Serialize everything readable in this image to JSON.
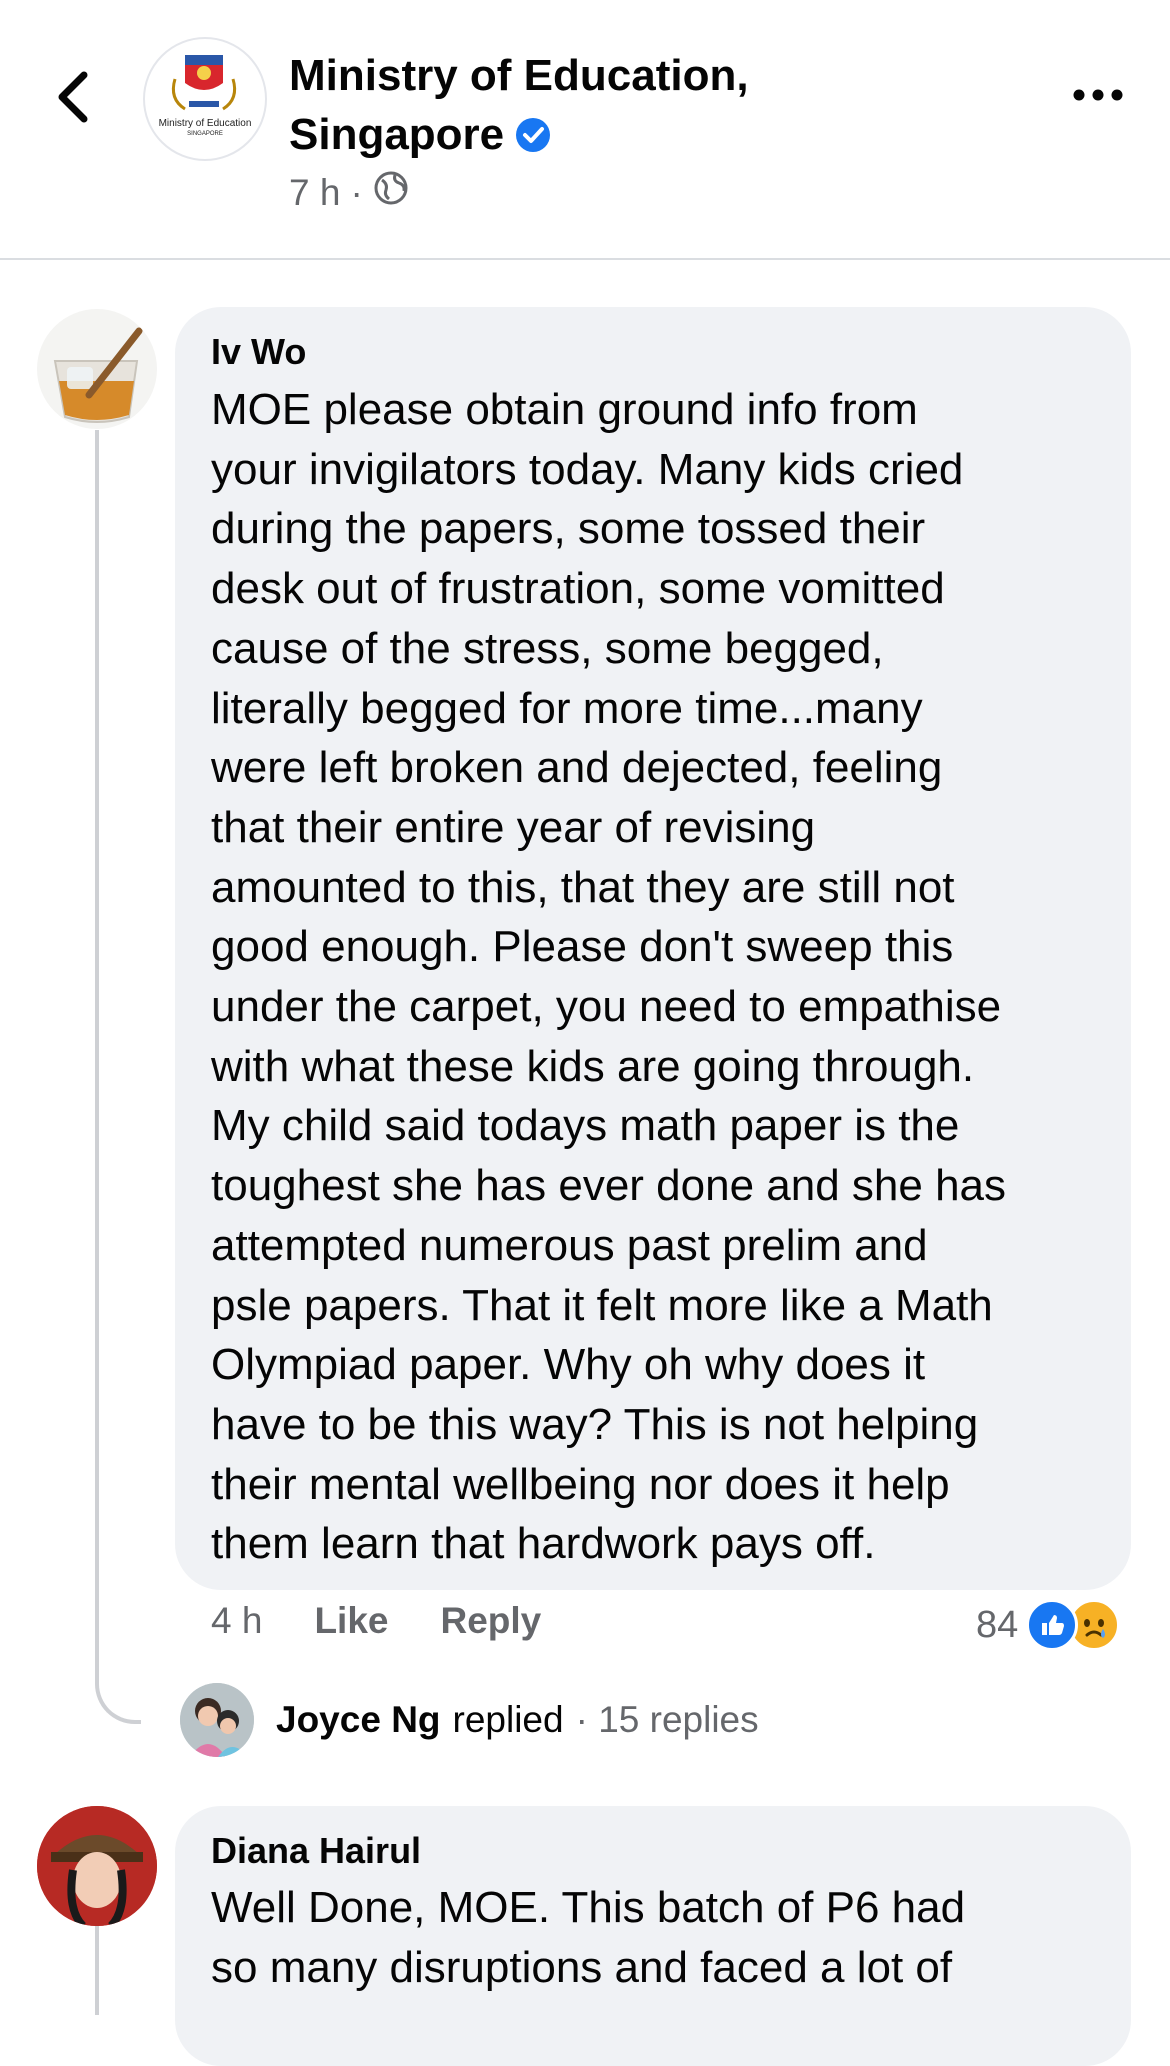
{
  "header": {
    "page_name": "Ministry of Education, Singapore",
    "logo_text": "Ministry of Education",
    "logo_subtext": "SINGAPORE",
    "time": "7 h",
    "separator": "·"
  },
  "comments": [
    {
      "author": "Iv Wo",
      "text": "MOE please obtain ground info from\nyour invigilators today. Many kids cried\nduring the papers, some tossed their\ndesk out of frustration, some vomitted\ncause of the stress, some begged,\nliterally begged for more time...many\nwere left broken and dejected, feeling\nthat their entire year of revising\namounted to this, that they are still not\ngood enough.  Please don't sweep this\nunder the carpet, you need to empathise\nwith what these kids are going through.\nMy child said todays math paper is the\ntoughest she has ever done and she has\nattempted numerous  past prelim and\npsle papers. That it felt more like a Math\nOlympiad paper. Why oh why does it\nhave to be this way? This is not helping\ntheir mental wellbeing nor does it help\nthem learn that hardwork pays off.",
      "time": "4 h",
      "like_label": "Like",
      "reply_label": "Reply",
      "reaction_count": "84",
      "reply_author": "Joyce Ng",
      "reply_verb": "replied",
      "reply_count": "· 15 replies"
    },
    {
      "author": "Diana Hairul",
      "text": "Well Done, MOE. This batch of P6 had\nso many disruptions and faced a lot of"
    }
  ],
  "icons": {
    "back": "chevron-left-icon",
    "more": "more-dots-icon",
    "verified": "verified-badge-icon",
    "privacy": "globe-icon",
    "like_reaction": "like-reaction-icon",
    "sad_reaction": "sad-reaction-icon"
  },
  "colors": {
    "facebook_blue": "#1877f2",
    "secondary_text": "#65676b",
    "bubble": "#f0f2f5",
    "sad_yellow": "#f7b125"
  }
}
